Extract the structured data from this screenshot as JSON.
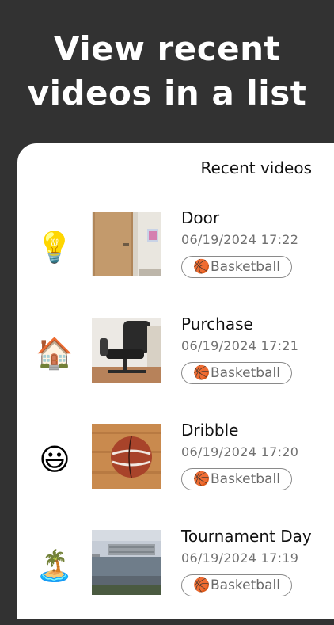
{
  "headline": {
    "line1": "View recent",
    "line2": "videos in a list"
  },
  "panel": {
    "title": "Recent videos"
  },
  "videos": [
    {
      "emoji": "💡",
      "title": "Door",
      "date": "06/19/2024 17:22",
      "tag_icon": "🏀",
      "tag": "Basketball",
      "thumb": "door"
    },
    {
      "emoji": "🏠",
      "title": "Purchase",
      "date": "06/19/2024 17:21",
      "tag_icon": "🏀",
      "tag": "Basketball",
      "thumb": "chair"
    },
    {
      "emoji": "😃",
      "title": "Dribble",
      "date": "06/19/2024 17:20",
      "tag_icon": "🏀",
      "tag": "Basketball",
      "thumb": "ball"
    },
    {
      "emoji": "🏝️",
      "title": "Tournament Day",
      "date": "06/19/2024 17:19",
      "tag_icon": "🏀",
      "tag": "Basketball",
      "thumb": "building"
    }
  ]
}
